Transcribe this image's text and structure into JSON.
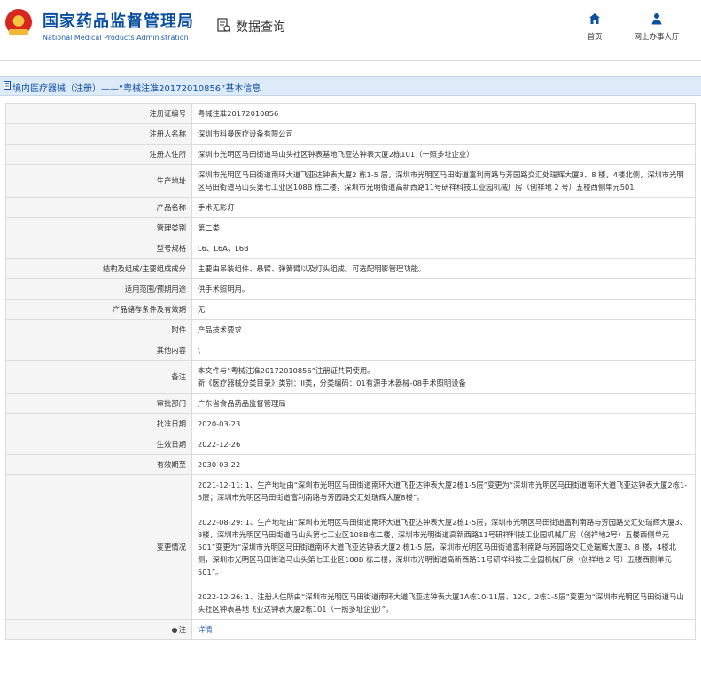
{
  "header": {
    "title_cn": "国家药品监督管理局",
    "title_en": "National Medical Products Administration",
    "query_title": "数据查询",
    "nav": [
      {
        "label": "首页",
        "icon": "home-icon"
      },
      {
        "label": "网上办事大厅",
        "icon": "user-icon"
      }
    ]
  },
  "breadcrumb": {
    "text": "境内医疗器械（注册）——“粤械注准20172010856”基本信息"
  },
  "fields": [
    {
      "label": "注册证编号",
      "value": "粤械注准20172010856"
    },
    {
      "label": "注册人名称",
      "value": "深圳市科曼医疗设备有限公司"
    },
    {
      "label": "注册人住所",
      "value": "深圳市光明区马田街道马山头社区钟表基地飞亚达钟表大厦2栋101（一照多址企业）"
    },
    {
      "label": "生产地址",
      "value": "深圳市光明区马田街道南环大道飞亚达钟表大厦2 栋1-5 层，深圳市光明区马田街道富利南路与芳园路交汇处瑞辉大厦3、8 楼，4楼北侧，深圳市光明区马田街道马山头第七工业区108B 栋二楼，深圳市光明街道高新西路11号研祥科技工业园机械厂房（创祥地 2 号）五楼西侧单元501"
    },
    {
      "label": "产品名称",
      "value": "手术无影灯"
    },
    {
      "label": "管理类别",
      "value": "第二类"
    },
    {
      "label": "型号规格",
      "value": "L6、L6A、L6B"
    },
    {
      "label": "结构及组成/主要组成成分",
      "value": "主要由吊装组件、悬臂、弹簧臂以及灯头组成。可选配明影管理功能。"
    },
    {
      "label": "适用范围/预期用途",
      "value": "供手术照明用。"
    },
    {
      "label": "产品储存条件及有效期",
      "value": "无"
    },
    {
      "label": "附件",
      "value": "产品技术要求"
    },
    {
      "label": "其他内容",
      "value": "\\"
    },
    {
      "label": "备注",
      "lines": [
        "本文件与“粤械注准20172010856”注册证共同使用。",
        "新《医疗器械分类目录》类别：II类，分类编码：01有源手术器械-08手术照明设备"
      ]
    },
    {
      "label": "审批部门",
      "value": "广东省食品药品监督管理局"
    },
    {
      "label": "批准日期",
      "value": "2020-03-23"
    },
    {
      "label": "生效日期",
      "value": "2022-12-26"
    },
    {
      "label": "有效期至",
      "value": "2030-03-22"
    },
    {
      "label": "变更情况",
      "paragraphs": [
        "2021-12-11: 1、生产地址由“深圳市光明区马田街道南环大道飞亚达钟表大厦2栋1-5层”变更为“深圳市光明区马田街道南环大道飞亚达钟表大厦2栋1-5层；深圳市光明区马田街道富利南路与芳园路交汇处瑞辉大厦8楼”。",
        "2022-08-29: 1、生产地址由“深圳市光明区马田街道南环大道飞亚达钟表大厦2栋1-5层，深圳市光明区马田街道富利南路与芳园路交汇处瑞辉大厦3、8楼，深圳市光明区马田街道马山头第七工业区108B栋二楼，深圳市光明街道高新西路11号研祥科技工业园机械厂房（创祥地2号）五楼西侧单元501”变更为“深圳市光明区马田街道南环大道飞亚达钟表大厦2 栋1-5 层，深圳市光明区马田街道富利南路与芳园路交汇处瑞辉大厦3、8 楼，4楼北侧，深圳市光明区马田街道马山头第七工业区108B 栋二楼，深圳市光明街道高新西路11号研祥科技工业园机械厂房（创祥地 2 号）五楼西侧单元501”。",
        "2022-12-26: 1、注册人住所由“深圳市光明区马田街道南环大道飞亚达钟表大厦1A栋10-11层、12C，2栋1-5层”变更为“深圳市光明区马田街道马山头社区钟表基地飞亚达钟表大厦2栋101（一照多址企业）”。"
      ]
    },
    {
      "label": "注",
      "value": "详情",
      "icon": "pin-icon"
    }
  ],
  "colors": {
    "brand_blue": "#0b4fa1",
    "breadcrumb_bg": "#ddeaf7",
    "label_bg": "#f5f5f5",
    "link_blue": "#2563b8"
  }
}
